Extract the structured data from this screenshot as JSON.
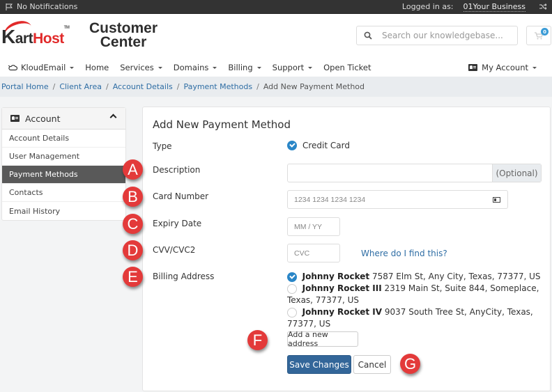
{
  "topbar": {
    "notifications": "No Notifications",
    "logged_in_label": "Logged in as:",
    "business_name": "01Your Business",
    "icons": {
      "notifications": "flag-icon",
      "switch": "shuffle-icon"
    }
  },
  "header": {
    "logo": {
      "brand_k": "K",
      "brand_art": "art",
      "brand_host": "Host",
      "tm": "TM",
      "tagline_line1": "Customer",
      "tagline_line2": "Center"
    },
    "search": {
      "placeholder": "Search our knowledgebase...",
      "icon": "search-icon"
    },
    "cart": {
      "count": "0",
      "icon": "cart-icon"
    }
  },
  "nav": {
    "items": [
      {
        "label": "KloudEmail",
        "dropdown": true,
        "icon": "cloud-icon"
      },
      {
        "label": "Home",
        "dropdown": false
      },
      {
        "label": "Services",
        "dropdown": true
      },
      {
        "label": "Domains",
        "dropdown": true
      },
      {
        "label": "Billing",
        "dropdown": true
      },
      {
        "label": "Support",
        "dropdown": true
      },
      {
        "label": "Open Ticket",
        "dropdown": false
      }
    ],
    "account": {
      "label": "My Account",
      "icon": "id-card-icon"
    }
  },
  "breadcrumb": {
    "items": [
      "Portal Home",
      "Client Area",
      "Account Details",
      "Payment Methods"
    ],
    "current": "Add New Payment Method",
    "separator": "/"
  },
  "sidebar": {
    "title": "Account",
    "items": [
      {
        "label": "Account Details",
        "active": false
      },
      {
        "label": "User Management",
        "active": false
      },
      {
        "label": "Payment Methods",
        "active": true
      },
      {
        "label": "Contacts",
        "active": false
      },
      {
        "label": "Email History",
        "active": false
      }
    ]
  },
  "form": {
    "title": "Add New Payment Method",
    "type": {
      "label": "Type",
      "value": "Credit Card"
    },
    "description": {
      "label": "Description",
      "value": "",
      "addon": "(Optional)"
    },
    "card_number": {
      "label": "Card Number",
      "placeholder": "1234 1234 1234 1234"
    },
    "expiry": {
      "label": "Expiry Date",
      "placeholder": "MM / YY"
    },
    "cvv": {
      "label": "CVV/CVC2",
      "placeholder": "CVC",
      "help_link": "Where do I find this?"
    },
    "billing": {
      "label": "Billing Address",
      "addresses": [
        {
          "name": "Johnny Rocket",
          "address": "7587 Elm St, Any City, Texas, 77377, US",
          "selected": true
        },
        {
          "name": "Johnny Rocket III",
          "address": "2319 Main St, Suite 844, Someplace, Texas, 77377, US",
          "selected": false
        },
        {
          "name": "Johnny Rocket IV",
          "address": "9037 South Tree St, AnyCity, Texas, 77377, US",
          "selected": false
        }
      ]
    },
    "add_address_button": "Add a new address",
    "save_button": "Save Changes",
    "cancel_button": "Cancel"
  },
  "annotations": [
    "A",
    "B",
    "C",
    "D",
    "E",
    "F",
    "G"
  ],
  "colors": {
    "primary": "#336699",
    "link": "#2e6da4",
    "check": "#2a86c7",
    "marker": "#e33a3a",
    "brand_red": "#e12a2a",
    "topbar": "#333333"
  }
}
